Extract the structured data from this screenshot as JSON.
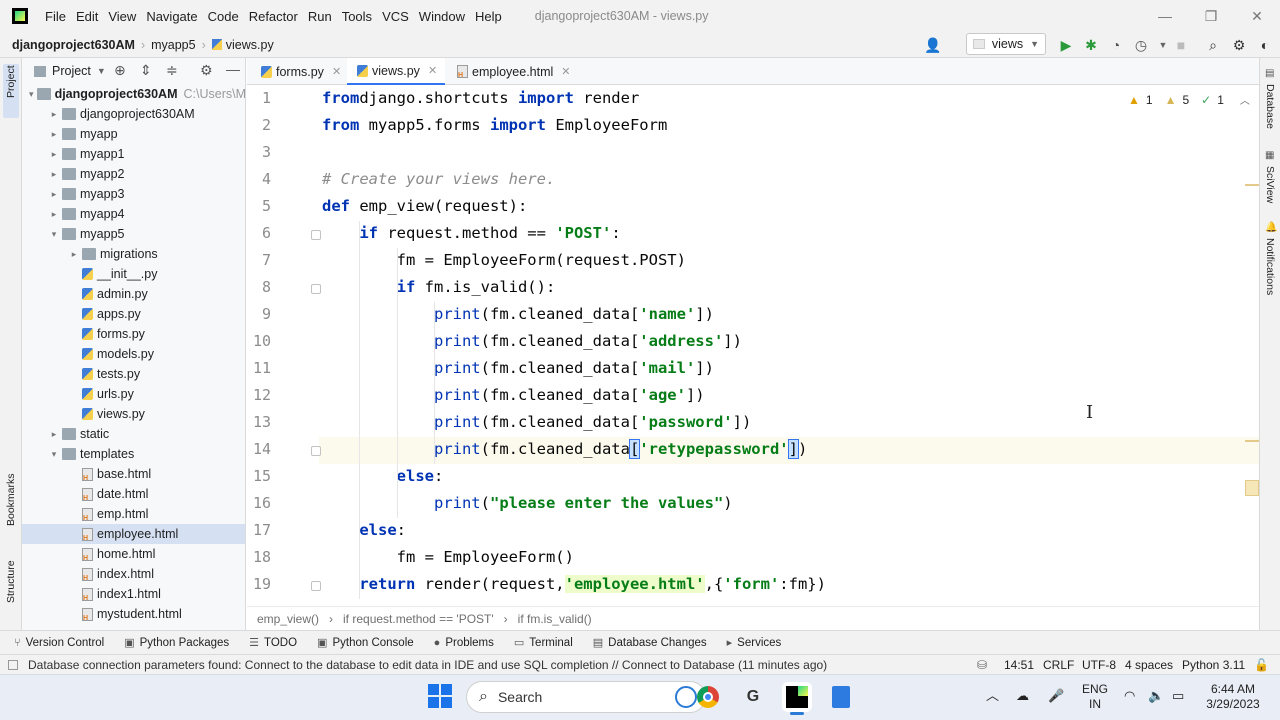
{
  "menu": [
    "File",
    "Edit",
    "View",
    "Navigate",
    "Code",
    "Refactor",
    "Run",
    "Tools",
    "VCS",
    "Window",
    "Help"
  ],
  "window_title": "djangoproject630AM - views.py",
  "nav": {
    "project": "djangoproject630AM",
    "folder": "myapp5",
    "file": "views.py",
    "run_config": "views"
  },
  "project_panel": {
    "title": "Project"
  },
  "side_labels": {
    "project": "Project",
    "bookmarks": "Bookmarks",
    "structure": "Structure",
    "database": "Database",
    "sciview": "SciView",
    "notifications": "Notifications"
  },
  "tree": [
    {
      "label": "djangoproject630AM",
      "extra": "C:\\Users\\M",
      "indent": 0,
      "arrow": "▾",
      "type": "root",
      "bold": true
    },
    {
      "label": "djangoproject630AM",
      "indent": 1,
      "arrow": "▸",
      "type": "folder"
    },
    {
      "label": "myapp",
      "indent": 1,
      "arrow": "▸",
      "type": "folder"
    },
    {
      "label": "myapp1",
      "indent": 1,
      "arrow": "▸",
      "type": "folder"
    },
    {
      "label": "myapp2",
      "indent": 1,
      "arrow": "▸",
      "type": "folder"
    },
    {
      "label": "myapp3",
      "indent": 1,
      "arrow": "▸",
      "type": "folder"
    },
    {
      "label": "myapp4",
      "indent": 1,
      "arrow": "▸",
      "type": "folder"
    },
    {
      "label": "myapp5",
      "indent": 1,
      "arrow": "▾",
      "type": "folder"
    },
    {
      "label": "migrations",
      "indent": 2,
      "arrow": "▸",
      "type": "folder"
    },
    {
      "label": "__init__.py",
      "indent": 2,
      "arrow": "",
      "type": "py"
    },
    {
      "label": "admin.py",
      "indent": 2,
      "arrow": "",
      "type": "py"
    },
    {
      "label": "apps.py",
      "indent": 2,
      "arrow": "",
      "type": "py"
    },
    {
      "label": "forms.py",
      "indent": 2,
      "arrow": "",
      "type": "py"
    },
    {
      "label": "models.py",
      "indent": 2,
      "arrow": "",
      "type": "py"
    },
    {
      "label": "tests.py",
      "indent": 2,
      "arrow": "",
      "type": "py"
    },
    {
      "label": "urls.py",
      "indent": 2,
      "arrow": "",
      "type": "py"
    },
    {
      "label": "views.py",
      "indent": 2,
      "arrow": "",
      "type": "py"
    },
    {
      "label": "static",
      "indent": 1,
      "arrow": "▸",
      "type": "folder"
    },
    {
      "label": "templates",
      "indent": 1,
      "arrow": "▾",
      "type": "folder"
    },
    {
      "label": "base.html",
      "indent": 2,
      "arrow": "",
      "type": "html"
    },
    {
      "label": "date.html",
      "indent": 2,
      "arrow": "",
      "type": "html"
    },
    {
      "label": "emp.html",
      "indent": 2,
      "arrow": "",
      "type": "html"
    },
    {
      "label": "employee.html",
      "indent": 2,
      "arrow": "",
      "type": "html",
      "selected": true
    },
    {
      "label": "home.html",
      "indent": 2,
      "arrow": "",
      "type": "html"
    },
    {
      "label": "index.html",
      "indent": 2,
      "arrow": "",
      "type": "html"
    },
    {
      "label": "index1.html",
      "indent": 2,
      "arrow": "",
      "type": "html"
    },
    {
      "label": "mystudent.html",
      "indent": 2,
      "arrow": "",
      "type": "html"
    }
  ],
  "tabs": [
    {
      "label": "forms.py",
      "active": false
    },
    {
      "label": "views.py",
      "active": true
    },
    {
      "label": "employee.html",
      "active": false
    }
  ],
  "inspections": {
    "warnings": "1",
    "weak": "5",
    "typos": "1"
  },
  "code": [
    [
      [
        "kwb",
        "from"
      ],
      [
        "",
        "django.shortcuts "
      ],
      [
        "kwb",
        "import"
      ],
      [
        "",
        " render"
      ]
    ],
    [
      [
        "kwb",
        "from"
      ],
      [
        "",
        " myapp5.forms "
      ],
      [
        "kwb",
        "import"
      ],
      [
        "",
        " EmployeeForm"
      ]
    ],
    [],
    [
      [
        "cmt",
        "# Create your views here."
      ]
    ],
    [
      [
        "kwb",
        "def"
      ],
      [
        "",
        " emp_view(request):"
      ]
    ],
    [
      [
        "",
        "    "
      ],
      [
        "kwb",
        "if"
      ],
      [
        "",
        " request.method == "
      ],
      [
        "str",
        "'POST'"
      ],
      [
        "",
        ":"
      ]
    ],
    [
      [
        "",
        "        fm = EmployeeForm(request.POST)"
      ]
    ],
    [
      [
        "",
        "        "
      ],
      [
        "kwb",
        "if"
      ],
      [
        "",
        " fm.is_valid():"
      ]
    ],
    [
      [
        "",
        "            "
      ],
      [
        "kw",
        "print"
      ],
      [
        "",
        "(fm.cleaned_data["
      ],
      [
        "str",
        "'name'"
      ],
      [
        "",
        "])"
      ]
    ],
    [
      [
        "",
        "            "
      ],
      [
        "kw",
        "print"
      ],
      [
        "",
        "(fm.cleaned_data["
      ],
      [
        "str",
        "'address'"
      ],
      [
        "",
        "])"
      ]
    ],
    [
      [
        "",
        "            "
      ],
      [
        "kw",
        "print"
      ],
      [
        "",
        "(fm.cleaned_data["
      ],
      [
        "str",
        "'mail'"
      ],
      [
        "",
        "])"
      ]
    ],
    [
      [
        "",
        "            "
      ],
      [
        "kw",
        "print"
      ],
      [
        "",
        "(fm.cleaned_data["
      ],
      [
        "str",
        "'age'"
      ],
      [
        "",
        "])"
      ]
    ],
    [
      [
        "",
        "            "
      ],
      [
        "kw",
        "print"
      ],
      [
        "",
        "(fm.cleaned_data["
      ],
      [
        "str",
        "'password'"
      ],
      [
        "",
        "])"
      ]
    ],
    [
      [
        "",
        "            "
      ],
      [
        "kw",
        "print"
      ],
      [
        "",
        "(fm.cleaned_data"
      ],
      [
        "brk",
        "["
      ],
      [
        "str",
        "'retypepassword'"
      ],
      [
        "brk",
        "]"
      ],
      [
        "",
        ")"
      ]
    ],
    [
      [
        "",
        "        "
      ],
      [
        "kwb",
        "else"
      ],
      [
        "",
        ":"
      ]
    ],
    [
      [
        "",
        "            "
      ],
      [
        "kw",
        "print"
      ],
      [
        "",
        "("
      ],
      [
        "str",
        "\"please enter the values\""
      ],
      [
        "",
        ")"
      ]
    ],
    [
      [
        "",
        "    "
      ],
      [
        "kwb",
        "else"
      ],
      [
        "",
        ":"
      ]
    ],
    [
      [
        "",
        "        fm = EmployeeForm()"
      ]
    ],
    [
      [
        "",
        "    "
      ],
      [
        "kwb",
        "return"
      ],
      [
        "",
        " render(request,"
      ],
      [
        "str tplstr",
        "'employee.html'"
      ],
      [
        "",
        ",{"
      ],
      [
        "str",
        "'form'"
      ],
      [
        "",
        ":fm})"
      ]
    ]
  ],
  "current_line": 14,
  "breadcrumb": [
    "emp_view()",
    "if request.method == 'POST'",
    "if fm.is_valid()"
  ],
  "tool_windows": [
    "Version Control",
    "Python Packages",
    "TODO",
    "Python Console",
    "Problems",
    "Terminal",
    "Database Changes",
    "Services"
  ],
  "status": {
    "message": "Database connection parameters found: Connect to the database to edit data in IDE and use SQL completion // Connect to Database (11 minutes ago)",
    "position": "14:51",
    "line_sep": "CRLF",
    "encoding": "UTF-8",
    "indent": "4 spaces",
    "interpreter": "Python 3.11"
  },
  "taskbar": {
    "search_placeholder": "Search",
    "lang_top": "ENG",
    "lang_bottom": "IN",
    "time": "6:44 AM",
    "date": "3/29/2023"
  }
}
